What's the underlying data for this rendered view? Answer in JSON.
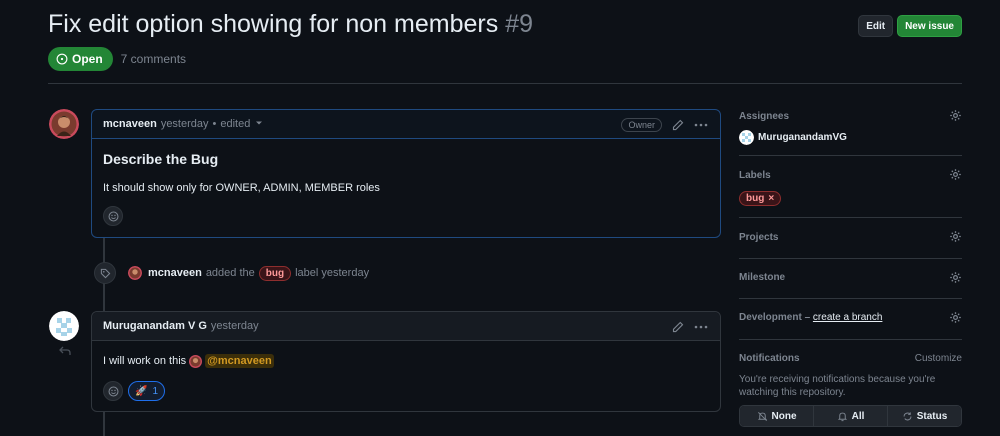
{
  "issue": {
    "title": "Fix edit option showing for non members",
    "number": "#9",
    "state": "Open",
    "comments_count": "7 comments",
    "edit_label": "Edit",
    "new_issue_label": "New issue"
  },
  "comments": [
    {
      "author": "mcnaveen",
      "time": "yesterday",
      "separator": "•",
      "edited": "edited",
      "badge": "Owner",
      "heading": "Describe the Bug",
      "body": "It should show only for OWNER, ADMIN, MEMBER roles"
    },
    {
      "author": "Muruganandam V G",
      "time": "yesterday",
      "body_prefix": "I will work on this",
      "mention": "@mcnaveen",
      "reaction_emoji": "🚀",
      "reaction_count": "1"
    }
  ],
  "event": {
    "actor": "mcnaveen",
    "action": "added the",
    "label": "bug",
    "suffix": "label yesterday"
  },
  "sidebar": {
    "assignees_title": "Assignees",
    "assignee": "MuruganandamVG",
    "labels_title": "Labels",
    "label": "bug",
    "label_remove": "×",
    "projects_title": "Projects",
    "milestone_title": "Milestone",
    "development_title": "Development –",
    "development_link": "create a branch",
    "notifications_title": "Notifications",
    "customize": "Customize",
    "notif_text": "You're receiving notifications because you're watching this repository.",
    "btn_none": "None",
    "btn_all": "All",
    "btn_status": "Status"
  },
  "colors": {
    "background": "#0d1117",
    "open_green": "#238636",
    "owner_border": "#1f4a80",
    "label_red": "#ff9a9a",
    "mention": "#d29922"
  }
}
